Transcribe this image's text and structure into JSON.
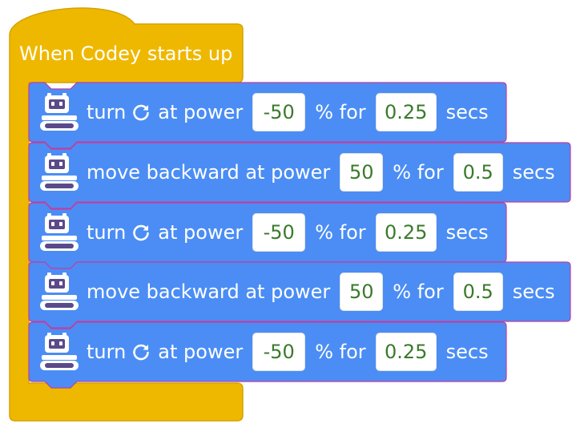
{
  "colors": {
    "hat_fill": "#efb800",
    "hat_stroke": "#d4a202",
    "motion_fill": "#4b8df4",
    "motion_stroke": "#bf3fa0",
    "field_text": "#3a7a2b"
  },
  "hat": {
    "label": "When Codey starts up"
  },
  "blocks": [
    {
      "type": "turn",
      "icon": "codey-robot-icon",
      "prefix": "turn",
      "rotate_icon": "rotate-clockwise-icon",
      "middle": "at power",
      "power": "-50",
      "for_label": "% for",
      "duration": "0.25",
      "unit": "secs"
    },
    {
      "type": "move",
      "icon": "codey-robot-icon",
      "prefix": "move backward at power",
      "power": "50",
      "for_label": "% for",
      "duration": "0.5",
      "unit": "secs"
    },
    {
      "type": "turn",
      "icon": "codey-robot-icon",
      "prefix": "turn",
      "rotate_icon": "rotate-clockwise-icon",
      "middle": "at power",
      "power": "-50",
      "for_label": "% for",
      "duration": "0.25",
      "unit": "secs"
    },
    {
      "type": "move",
      "icon": "codey-robot-icon",
      "prefix": "move backward at power",
      "power": "50",
      "for_label": "% for",
      "duration": "0.5",
      "unit": "secs"
    },
    {
      "type": "turn",
      "icon": "codey-robot-icon",
      "prefix": "turn",
      "rotate_icon": "rotate-clockwise-icon",
      "middle": "at power",
      "power": "-50",
      "for_label": "% for",
      "duration": "0.25",
      "unit": "secs"
    }
  ]
}
